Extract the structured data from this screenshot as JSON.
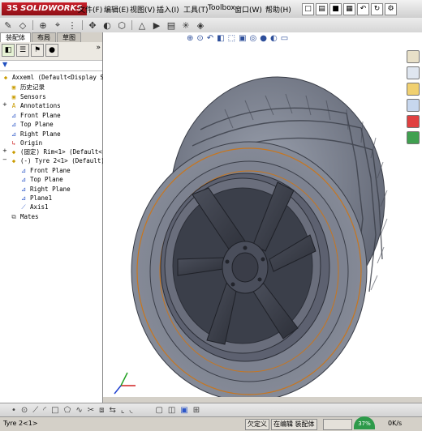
{
  "app": {
    "logo": "SOLIDWORKS",
    "logo_mark": "3S"
  },
  "menu": [
    {
      "label": "文件(F)"
    },
    {
      "label": "编辑(E)"
    },
    {
      "label": "视图(V)"
    },
    {
      "label": "插入(I)"
    },
    {
      "label": "工具(T)"
    },
    {
      "label": "Toolbox"
    },
    {
      "label": "窗口(W)"
    },
    {
      "label": "帮助(H)"
    }
  ],
  "panel": {
    "tabs": [
      "装配体",
      "布局",
      "草图"
    ],
    "filter_icon": "filter-icon"
  },
  "tree": [
    {
      "label": "Axxeml  (Default<Display S",
      "icon": "assembly-icon"
    },
    {
      "label": "历史记录",
      "icon": "history-icon"
    },
    {
      "label": "Sensors",
      "icon": "sensor-icon"
    },
    {
      "label": "Annotations",
      "icon": "annotation-icon"
    },
    {
      "label": "Front Plane",
      "icon": "plane-icon"
    },
    {
      "label": "Top Plane",
      "icon": "plane-icon"
    },
    {
      "label": "Right Plane",
      "icon": "plane-icon"
    },
    {
      "label": "Origin",
      "icon": "origin-icon"
    },
    {
      "label": "(固定) Rim<1> (Default<",
      "icon": "part-icon"
    },
    {
      "label": "(-) Tyre 2<1> (Default)",
      "icon": "part-icon"
    },
    {
      "label": "Front Plane",
      "icon": "plane-icon"
    },
    {
      "label": "Top Plane",
      "icon": "plane-icon"
    },
    {
      "label": "Right Plane",
      "icon": "plane-icon"
    },
    {
      "label": "Plane1",
      "icon": "plane-icon"
    },
    {
      "label": "Axis1",
      "icon": "axis-icon"
    },
    {
      "label": "Mates",
      "icon": "mates-icon"
    }
  ],
  "status": {
    "selection": "Tyre 2<1>",
    "defined": "欠定义",
    "mode": "在编辑 装配体",
    "speed": "37%",
    "rate": "0K/s"
  }
}
